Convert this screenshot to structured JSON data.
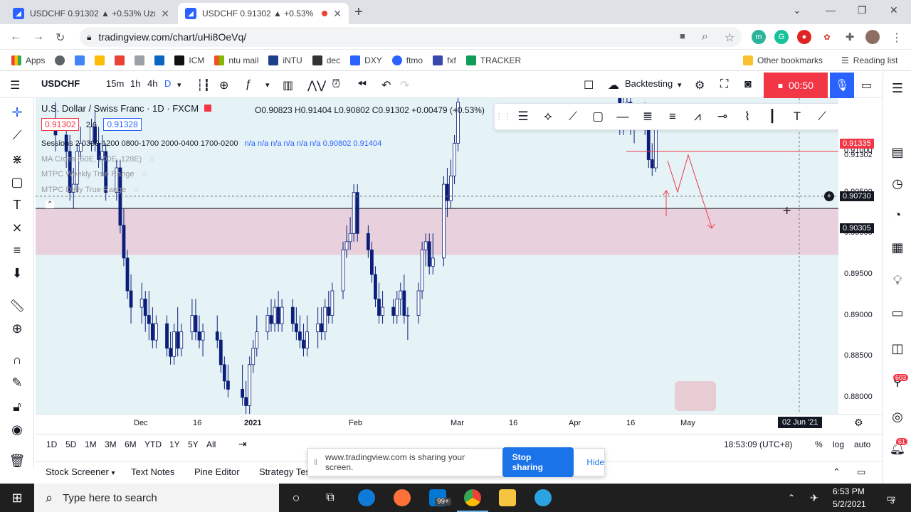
{
  "browser": {
    "tabs": [
      {
        "title": "USDCHF 0.91302 ▲ +0.53% Uzm",
        "active": false
      },
      {
        "title": "USDCHF 0.91302 ▲ +0.53%",
        "active": true
      }
    ],
    "url": "tradingview.com/chart/uHi8OeVq/",
    "bookmarks": [
      "Apps",
      "ICM",
      "ntu mail",
      "iNTU",
      "dec",
      "DXY",
      "ftmo",
      "fxf",
      "TRACKER"
    ],
    "other_bookmarks": "Other bookmarks",
    "reading_list": "Reading list"
  },
  "toolbar": {
    "symbol": "USDCHF",
    "intervals": [
      "15m",
      "1h",
      "4h",
      "D"
    ],
    "backtesting": "Backtesting",
    "timer": "00:50"
  },
  "legend": {
    "title": "U.S. Dollar / Swiss Franc · 1D · FXCM",
    "ohlc": "O0.90823 H0.91404 L0.90802 C0.91302 +0.00479 (+0.53%)",
    "bid": "0.91302",
    "spread": "2.6",
    "ask": "0.91328",
    "sessions": "Sessions 2 0300-1200 0800-1700 2000-0400 1700-0200",
    "sessions_values": "n/a n/a n/a n/a n/a n/a 0.90802 0.91404",
    "ind1": "MA Cross (50E, 200E, 128E)",
    "ind2": "MTPC Weekly True Range",
    "ind3": "MTPC Daily True Range"
  },
  "price_axis": {
    "ticks": [
      "0.91000",
      "0.90500",
      "0.90000",
      "0.89500",
      "0.89000",
      "0.88500",
      "0.88000"
    ],
    "labels": [
      {
        "text": "0.91335",
        "color": "#f23645"
      },
      {
        "text": "0.91302",
        "color": "#f23645"
      },
      {
        "text": "0.90730",
        "color": "#131722"
      },
      {
        "text": "0.90305",
        "color": "#131722"
      }
    ]
  },
  "time_axis": {
    "ticks": [
      "Dec",
      "16",
      "2021",
      "Feb",
      "Mar",
      "16",
      "Apr",
      "16",
      "May"
    ],
    "cursor": "02 Jun '21"
  },
  "ranges": [
    "1D",
    "5D",
    "1M",
    "3M",
    "6M",
    "YTD",
    "1Y",
    "5Y",
    "All"
  ],
  "clock": "18:53:09 (UTC+8)",
  "scale_opts": [
    "%",
    "log",
    "auto"
  ],
  "panels": [
    "Stock Screener",
    "Text Notes",
    "Pine Editor",
    "Strategy Tester"
  ],
  "share_bar": {
    "message": "www.tradingview.com is sharing your screen.",
    "stop": "Stop sharing",
    "hide": "Hide"
  },
  "taskbar": {
    "search_placeholder": "Type here to search",
    "time": "6:53 PM",
    "date": "5/2/2021",
    "mail_badge": "99+",
    "notif_badge": "3"
  },
  "right_badges": {
    "chat": "603",
    "alerts": "61"
  },
  "chart_data": {
    "type": "candlestick",
    "symbol": "USDCHF",
    "interval": "1D",
    "ylim": [
      0.878,
      0.9165
    ],
    "zone": [
      0.89738,
      0.90305
    ],
    "series": [
      {
        "date": "2020-11-13",
        "o": 0.914,
        "h": 0.916,
        "l": 0.91,
        "c": 0.912
      },
      {
        "date": "2020-11-16",
        "o": 0.912,
        "h": 0.914,
        "l": 0.908,
        "c": 0.91
      },
      {
        "date": "2020-11-17",
        "o": 0.91,
        "h": 0.912,
        "l": 0.904,
        "c": 0.905
      },
      {
        "date": "2020-11-18",
        "o": 0.905,
        "h": 0.908,
        "l": 0.903,
        "c": 0.906
      },
      {
        "date": "2020-11-19",
        "o": 0.906,
        "h": 0.911,
        "l": 0.905,
        "c": 0.91
      },
      {
        "date": "2020-11-20",
        "o": 0.91,
        "h": 0.913,
        "l": 0.909,
        "c": 0.911
      },
      {
        "date": "2020-11-23",
        "o": 0.911,
        "h": 0.914,
        "l": 0.91,
        "c": 0.913
      },
      {
        "date": "2020-11-24",
        "o": 0.913,
        "h": 0.915,
        "l": 0.91,
        "c": 0.911
      },
      {
        "date": "2020-11-25",
        "o": 0.911,
        "h": 0.913,
        "l": 0.908,
        "c": 0.909
      },
      {
        "date": "2020-11-26",
        "o": 0.909,
        "h": 0.912,
        "l": 0.907,
        "c": 0.91
      },
      {
        "date": "2020-11-27",
        "o": 0.91,
        "h": 0.911,
        "l": 0.904,
        "c": 0.905
      },
      {
        "date": "2020-11-30",
        "o": 0.905,
        "h": 0.909,
        "l": 0.904,
        "c": 0.908
      },
      {
        "date": "2020-12-01",
        "o": 0.908,
        "h": 0.909,
        "l": 0.9,
        "c": 0.901
      },
      {
        "date": "2020-12-02",
        "o": 0.901,
        "h": 0.903,
        "l": 0.896,
        "c": 0.897
      },
      {
        "date": "2020-12-03",
        "o": 0.897,
        "h": 0.898,
        "l": 0.892,
        "c": 0.893
      },
      {
        "date": "2020-12-04",
        "o": 0.893,
        "h": 0.895,
        "l": 0.889,
        "c": 0.891
      },
      {
        "date": "2020-12-07",
        "o": 0.891,
        "h": 0.894,
        "l": 0.889,
        "c": 0.892
      },
      {
        "date": "2020-12-08",
        "o": 0.892,
        "h": 0.893,
        "l": 0.888,
        "c": 0.89
      },
      {
        "date": "2020-12-09",
        "o": 0.89,
        "h": 0.893,
        "l": 0.887,
        "c": 0.889
      },
      {
        "date": "2020-12-10",
        "o": 0.889,
        "h": 0.891,
        "l": 0.886,
        "c": 0.887
      },
      {
        "date": "2020-12-11",
        "o": 0.887,
        "h": 0.89,
        "l": 0.886,
        "c": 0.889
      },
      {
        "date": "2020-12-14",
        "o": 0.889,
        "h": 0.89,
        "l": 0.885,
        "c": 0.886
      },
      {
        "date": "2020-12-15",
        "o": 0.886,
        "h": 0.888,
        "l": 0.884,
        "c": 0.885
      },
      {
        "date": "2020-12-16",
        "o": 0.885,
        "h": 0.889,
        "l": 0.884,
        "c": 0.888
      },
      {
        "date": "2020-12-17",
        "o": 0.888,
        "h": 0.891,
        "l": 0.885,
        "c": 0.886
      },
      {
        "date": "2020-12-18",
        "o": 0.886,
        "h": 0.889,
        "l": 0.885,
        "c": 0.888
      },
      {
        "date": "2020-12-21",
        "o": 0.888,
        "h": 0.892,
        "l": 0.887,
        "c": 0.89
      },
      {
        "date": "2020-12-22",
        "o": 0.89,
        "h": 0.892,
        "l": 0.887,
        "c": 0.888
      },
      {
        "date": "2020-12-23",
        "o": 0.888,
        "h": 0.89,
        "l": 0.886,
        "c": 0.887
      },
      {
        "date": "2020-12-24",
        "o": 0.887,
        "h": 0.889,
        "l": 0.885,
        "c": 0.888
      },
      {
        "date": "2020-12-28",
        "o": 0.888,
        "h": 0.89,
        "l": 0.886,
        "c": 0.887
      },
      {
        "date": "2020-12-29",
        "o": 0.887,
        "h": 0.888,
        "l": 0.883,
        "c": 0.884
      },
      {
        "date": "2020-12-30",
        "o": 0.884,
        "h": 0.885,
        "l": 0.881,
        "c": 0.882
      },
      {
        "date": "2020-12-31",
        "o": 0.882,
        "h": 0.884,
        "l": 0.88,
        "c": 0.881
      },
      {
        "date": "2021-01-04",
        "o": 0.881,
        "h": 0.884,
        "l": 0.879,
        "c": 0.88
      },
      {
        "date": "2021-01-05",
        "o": 0.88,
        "h": 0.882,
        "l": 0.878,
        "c": 0.879
      },
      {
        "date": "2021-01-06",
        "o": 0.879,
        "h": 0.885,
        "l": 0.878,
        "c": 0.884
      },
      {
        "date": "2021-01-07",
        "o": 0.884,
        "h": 0.887,
        "l": 0.883,
        "c": 0.886
      },
      {
        "date": "2021-01-08",
        "o": 0.886,
        "h": 0.89,
        "l": 0.885,
        "c": 0.888
      },
      {
        "date": "2021-01-11",
        "o": 0.888,
        "h": 0.891,
        "l": 0.887,
        "c": 0.89
      },
      {
        "date": "2021-01-12",
        "o": 0.89,
        "h": 0.892,
        "l": 0.888,
        "c": 0.889
      },
      {
        "date": "2021-01-13",
        "o": 0.889,
        "h": 0.892,
        "l": 0.888,
        "c": 0.891
      },
      {
        "date": "2021-01-14",
        "o": 0.891,
        "h": 0.893,
        "l": 0.888,
        "c": 0.889
      },
      {
        "date": "2021-01-15",
        "o": 0.889,
        "h": 0.892,
        "l": 0.888,
        "c": 0.891
      },
      {
        "date": "2021-01-18",
        "o": 0.891,
        "h": 0.892,
        "l": 0.888,
        "c": 0.889
      },
      {
        "date": "2021-01-19",
        "o": 0.889,
        "h": 0.891,
        "l": 0.887,
        "c": 0.888
      },
      {
        "date": "2021-01-20",
        "o": 0.888,
        "h": 0.89,
        "l": 0.886,
        "c": 0.887
      },
      {
        "date": "2021-01-21",
        "o": 0.887,
        "h": 0.889,
        "l": 0.885,
        "c": 0.886
      },
      {
        "date": "2021-01-22",
        "o": 0.886,
        "h": 0.89,
        "l": 0.885,
        "c": 0.888
      },
      {
        "date": "2021-01-25",
        "o": 0.888,
        "h": 0.891,
        "l": 0.886,
        "c": 0.889
      },
      {
        "date": "2021-01-26",
        "o": 0.889,
        "h": 0.891,
        "l": 0.887,
        "c": 0.888
      },
      {
        "date": "2021-01-27",
        "o": 0.888,
        "h": 0.892,
        "l": 0.887,
        "c": 0.891
      },
      {
        "date": "2021-01-28",
        "o": 0.891,
        "h": 0.893,
        "l": 0.889,
        "c": 0.89
      },
      {
        "date": "2021-01-29",
        "o": 0.89,
        "h": 0.894,
        "l": 0.889,
        "c": 0.893
      },
      {
        "date": "2021-02-01",
        "o": 0.893,
        "h": 0.899,
        "l": 0.892,
        "c": 0.898
      },
      {
        "date": "2021-02-02",
        "o": 0.898,
        "h": 0.901,
        "l": 0.897,
        "c": 0.899
      },
      {
        "date": "2021-02-03",
        "o": 0.899,
        "h": 0.902,
        "l": 0.898,
        "c": 0.9
      },
      {
        "date": "2021-02-04",
        "o": 0.9,
        "h": 0.906,
        "l": 0.899,
        "c": 0.905
      },
      {
        "date": "2021-02-05",
        "o": 0.905,
        "h": 0.906,
        "l": 0.899,
        "c": 0.9
      },
      {
        "date": "2021-02-08",
        "o": 0.9,
        "h": 0.901,
        "l": 0.897,
        "c": 0.898
      },
      {
        "date": "2021-02-09",
        "o": 0.898,
        "h": 0.899,
        "l": 0.894,
        "c": 0.895
      },
      {
        "date": "2021-02-10",
        "o": 0.895,
        "h": 0.896,
        "l": 0.891,
        "c": 0.892
      },
      {
        "date": "2021-02-11",
        "o": 0.892,
        "h": 0.894,
        "l": 0.889,
        "c": 0.89
      },
      {
        "date": "2021-02-12",
        "o": 0.89,
        "h": 0.893,
        "l": 0.889,
        "c": 0.891
      },
      {
        "date": "2021-02-15",
        "o": 0.891,
        "h": 0.892,
        "l": 0.889,
        "c": 0.89
      },
      {
        "date": "2021-02-16",
        "o": 0.89,
        "h": 0.893,
        "l": 0.889,
        "c": 0.892
      },
      {
        "date": "2021-02-17",
        "o": 0.892,
        "h": 0.894,
        "l": 0.89,
        "c": 0.893
      },
      {
        "date": "2021-02-18",
        "o": 0.893,
        "h": 0.895,
        "l": 0.889,
        "c": 0.89
      },
      {
        "date": "2021-02-19",
        "o": 0.89,
        "h": 0.891,
        "l": 0.887,
        "c": 0.89
      },
      {
        "date": "2021-02-22",
        "o": 0.89,
        "h": 0.894,
        "l": 0.889,
        "c": 0.893
      },
      {
        "date": "2021-02-23",
        "o": 0.893,
        "h": 0.899,
        "l": 0.892,
        "c": 0.898
      },
      {
        "date": "2021-02-24",
        "o": 0.898,
        "h": 0.9,
        "l": 0.896,
        "c": 0.899
      },
      {
        "date": "2021-02-25",
        "o": 0.899,
        "h": 0.9,
        "l": 0.895,
        "c": 0.896
      },
      {
        "date": "2021-02-26",
        "o": 0.896,
        "h": 0.9,
        "l": 0.895,
        "c": 0.897
      },
      {
        "date": "2021-03-01",
        "o": 0.897,
        "h": 0.907,
        "l": 0.896,
        "c": 0.906
      },
      {
        "date": "2021-03-02",
        "o": 0.906,
        "h": 0.908,
        "l": 0.902,
        "c": 0.904
      },
      {
        "date": "2021-03-03",
        "o": 0.904,
        "h": 0.909,
        "l": 0.903,
        "c": 0.907
      },
      {
        "date": "2021-03-04",
        "o": 0.907,
        "h": 0.912,
        "l": 0.906,
        "c": 0.911
      },
      {
        "date": "2021-03-05",
        "o": 0.911,
        "h": 0.9165,
        "l": 0.91,
        "c": 0.916
      },
      {
        "date": "2021-04-19",
        "o": 0.9165,
        "h": 0.917,
        "l": 0.912,
        "c": 0.913
      },
      {
        "date": "2021-04-20",
        "o": 0.913,
        "h": 0.9165,
        "l": 0.912,
        "c": 0.915
      },
      {
        "date": "2021-04-21",
        "o": 0.915,
        "h": 0.9165,
        "l": 0.913,
        "c": 0.916
      },
      {
        "date": "2021-04-22",
        "o": 0.916,
        "h": 0.9165,
        "l": 0.912,
        "c": 0.913
      },
      {
        "date": "2021-04-23",
        "o": 0.913,
        "h": 0.915,
        "l": 0.911,
        "c": 0.914
      },
      {
        "date": "2021-04-26",
        "o": 0.914,
        "h": 0.916,
        "l": 0.912,
        "c": 0.913
      },
      {
        "date": "2021-04-27",
        "o": 0.913,
        "h": 0.914,
        "l": 0.908,
        "c": 0.909
      },
      {
        "date": "2021-04-28",
        "o": 0.909,
        "h": 0.911,
        "l": 0.907,
        "c": 0.908
      },
      {
        "date": "2021-04-29",
        "o": 0.908,
        "h": 0.9135,
        "l": 0.9075,
        "c": 0.913
      }
    ]
  }
}
